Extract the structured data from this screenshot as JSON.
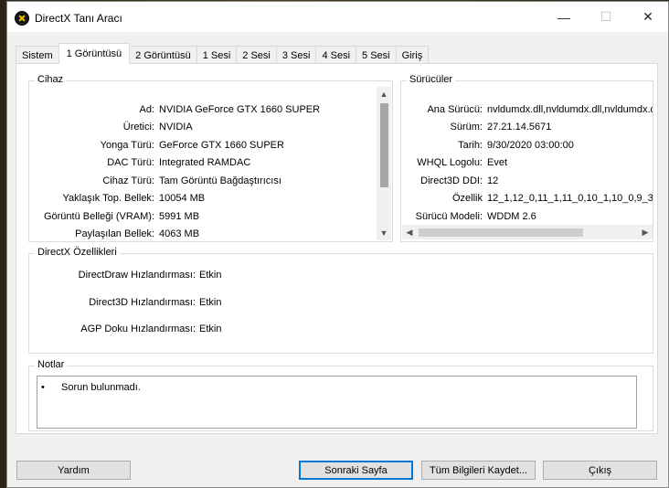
{
  "window": {
    "title": "DirectX Tanı Aracı",
    "controls": {
      "minimize": "—",
      "maximize": "☐",
      "close": "✕"
    }
  },
  "tabs": [
    {
      "label": "Sistem",
      "active": false
    },
    {
      "label": "1 Görüntüsü",
      "active": true
    },
    {
      "label": "2 Görüntüsü",
      "active": false
    },
    {
      "label": "1 Sesi",
      "active": false
    },
    {
      "label": "2 Sesi",
      "active": false
    },
    {
      "label": "3 Sesi",
      "active": false
    },
    {
      "label": "4 Sesi",
      "active": false
    },
    {
      "label": "5 Sesi",
      "active": false
    },
    {
      "label": "Giriş",
      "active": false
    }
  ],
  "device": {
    "title": "Cihaz",
    "rows": [
      {
        "label": "Ad:",
        "value": "NVIDIA GeForce GTX 1660 SUPER"
      },
      {
        "label": "Üretici:",
        "value": "NVIDIA"
      },
      {
        "label": "Yonga Türü:",
        "value": "GeForce GTX 1660 SUPER"
      },
      {
        "label": "DAC Türü:",
        "value": "Integrated RAMDAC"
      },
      {
        "label": "Cihaz Türü:",
        "value": "Tam Görüntü Bağdaştırıcısı"
      },
      {
        "label": "Yaklaşık Top. Bellek:",
        "value": "10054 MB"
      },
      {
        "label": "Görüntü Belleği (VRAM):",
        "value": "5991 MB"
      },
      {
        "label": "Paylaşılan Bellek:",
        "value": "4063 MB"
      }
    ]
  },
  "drivers": {
    "title": "Sürücüler",
    "rows": [
      {
        "label": "Ana Sürücü:",
        "value": "nvldumdx.dll,nvldumdx.dll,nvldumdx.d"
      },
      {
        "label": "Sürüm:",
        "value": "27.21.14.5671"
      },
      {
        "label": "Tarih:",
        "value": "9/30/2020 03:00:00"
      },
      {
        "label": "WHQL Logolu:",
        "value": "Evet"
      },
      {
        "label": "Direct3D DDI:",
        "value": "12"
      },
      {
        "label": "Özellik",
        "value": "12_1,12_0,11_1,11_0,10_1,10_0,9_3"
      },
      {
        "label": "Sürücü Modeli:",
        "value": "WDDM 2.6"
      }
    ]
  },
  "directx": {
    "title": "DirectX Özellikleri",
    "rows": [
      {
        "label": "DirectDraw Hızlandırması:",
        "value": "Etkin"
      },
      {
        "label": "Direct3D Hızlandırması:",
        "value": "Etkin"
      },
      {
        "label": "AGP Doku Hızlandırması:",
        "value": "Etkin"
      }
    ]
  },
  "notes": {
    "title": "Notlar",
    "bullet": "•",
    "items": [
      "Sorun bulunmadı."
    ]
  },
  "buttons": {
    "help": "Yardım",
    "next_page": "Sonraki Sayfa",
    "save_all": "Tüm Bilgileri Kaydet...",
    "exit": "Çıkış"
  },
  "scroll_arrows": {
    "up": "▲",
    "down": "▼",
    "left": "◀",
    "right": "▶"
  },
  "colors": {
    "window_bg": "#f0f0f0",
    "panel_bg": "#ffffff",
    "default_button_border": "#0078d7",
    "scroll_thumb": "#a6a6a6"
  },
  "icons": [
    "directx-app-icon",
    "minimize-icon",
    "maximize-icon",
    "close-icon",
    "scroll-up-icon",
    "scroll-down-icon",
    "scroll-left-icon",
    "scroll-right-icon"
  ]
}
